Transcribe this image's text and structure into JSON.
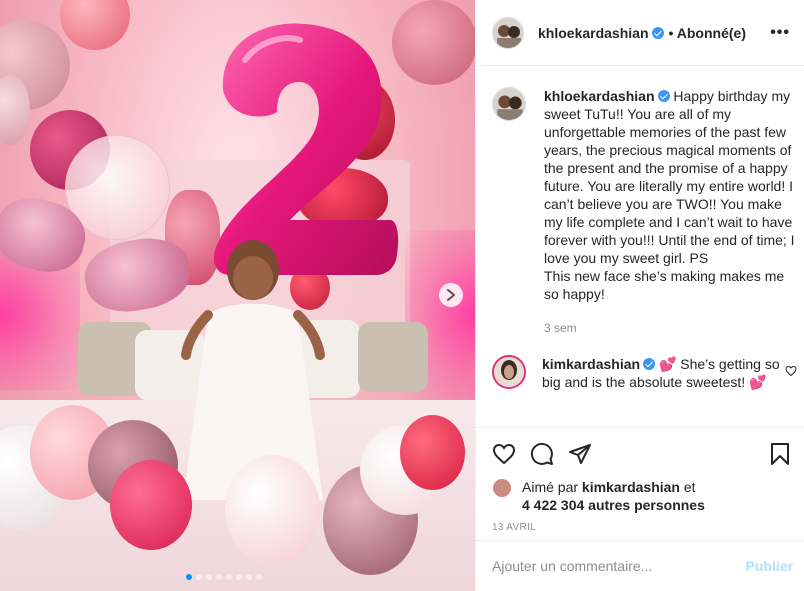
{
  "post": {
    "author": "khloekardashian",
    "follow_status": "• Abonné(e)",
    "more_label": "•••",
    "caption": "Happy birthday my sweet TuTu!! You are all of my unforgettable memories of the past few years, the precious magical moments of the present and the promise of a happy future. You are literally my entire world! I can’t believe you are TWO!! You make my life complete and I can’t wait to have forever with you!!! Until the end of time; I love you my sweet girl. PS",
    "caption_ps": "This new face she’s making makes me so happy!",
    "caption_time": "3 sem",
    "comments": [
      {
        "author": "kimkardashian",
        "text": "💕 She’s getting so big and is the absolute sweetest! 💕"
      }
    ],
    "liked_by_prefix": "Aimé par",
    "liked_by_user": "kimkardashian",
    "liked_by_and": "et",
    "liked_by_others": "4 422 304 autres personnes",
    "date": "13 AVRIL"
  },
  "add_comment": {
    "placeholder": "Ajouter un commentaire...",
    "post_label": "Publier"
  },
  "carousel": {
    "slide_count": 8,
    "active_index": 0
  },
  "colors": {
    "accent": "#0095f6",
    "verified": "#3897f0",
    "post_disabled": "#b2dffc"
  }
}
